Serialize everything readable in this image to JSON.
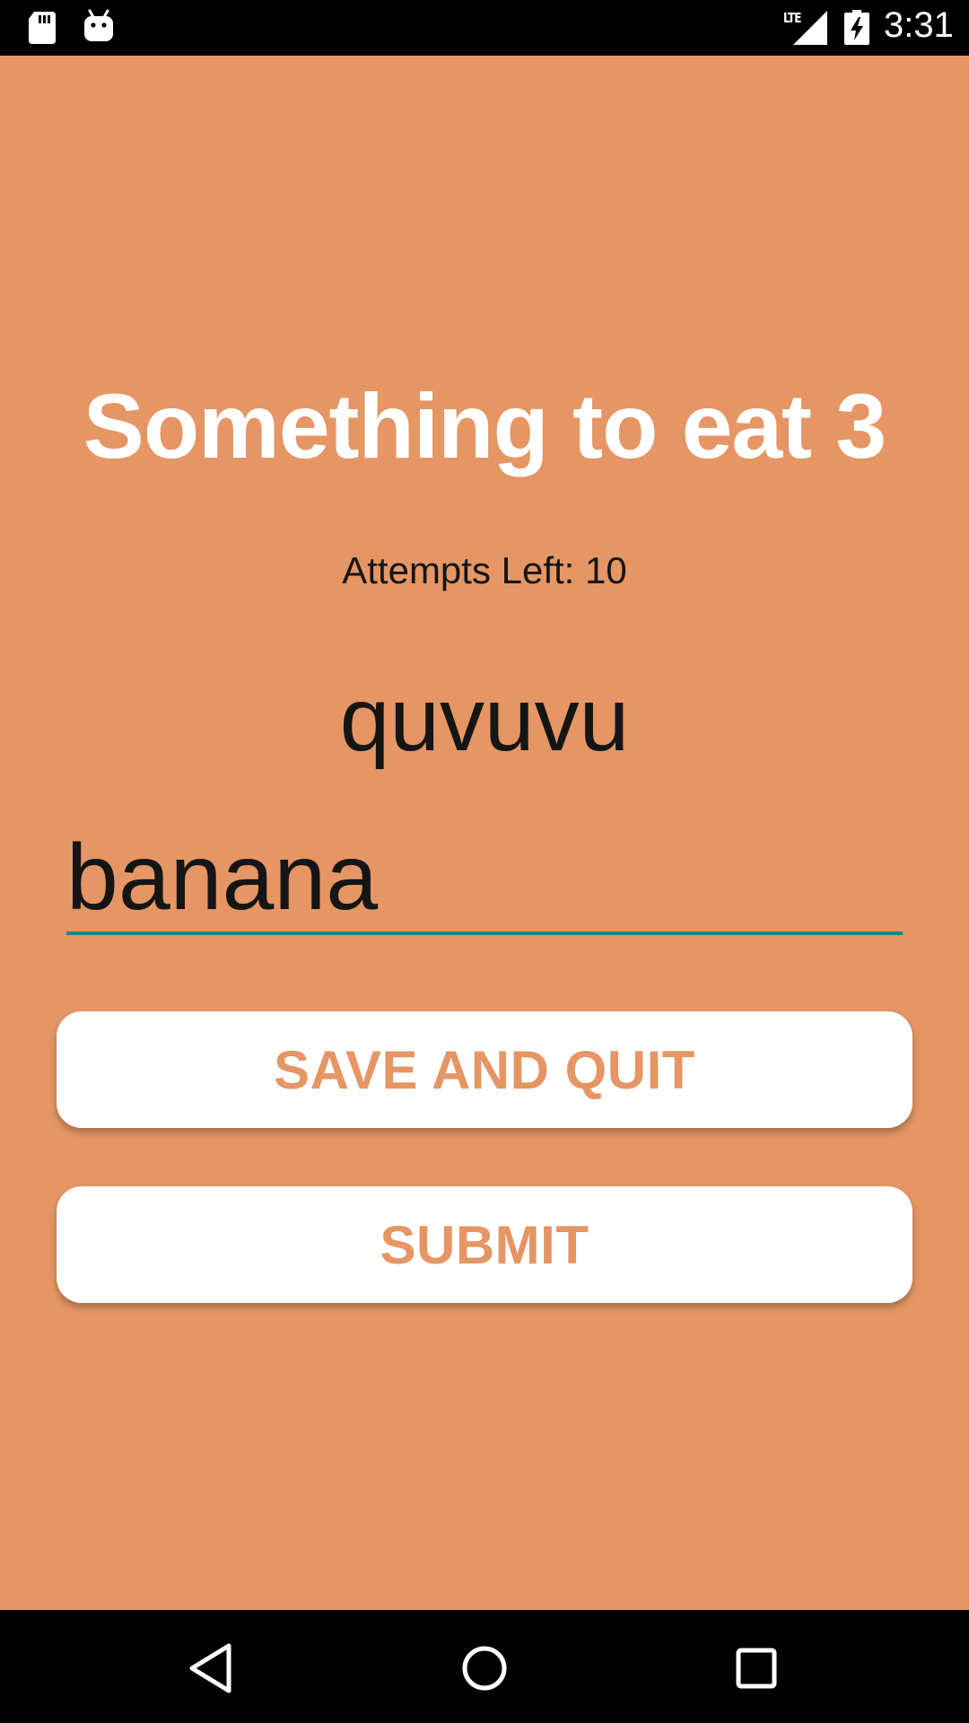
{
  "status_bar": {
    "time": "3:31",
    "network": "LTE",
    "icons": [
      "sd-card-icon",
      "android-icon",
      "signal-icon",
      "battery-charging-icon"
    ]
  },
  "game": {
    "title": "Something to eat 3",
    "attempts_label": "Attempts Left: 10",
    "scrambled_word": "quvuvu",
    "guess_value": "banana"
  },
  "buttons": {
    "save_quit": "SAVE AND QUIT",
    "submit": "SUBMIT"
  },
  "nav_bar": {
    "icons": [
      "back-icon",
      "home-icon",
      "recents-icon"
    ]
  },
  "colors": {
    "background": "#e59664",
    "accent": "#0f8c82",
    "button_text": "#e59664"
  }
}
